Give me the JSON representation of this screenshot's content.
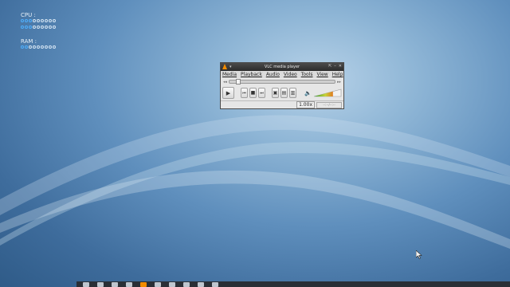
{
  "monitor": {
    "cpu_label": "CPU :",
    "ram_label": "RAM :",
    "cpu_rows": [
      {
        "on": 3,
        "total": 9
      },
      {
        "on": 3,
        "total": 9
      }
    ],
    "ram_rows": [
      {
        "on": 2,
        "total": 9
      }
    ]
  },
  "vlc": {
    "title": "VLC media player",
    "window_controls": [
      "⇱",
      "–",
      "✕"
    ],
    "menu": [
      "Media",
      "Playback",
      "Audio",
      "Video",
      "Tools",
      "View",
      "Help"
    ],
    "speed": "1.00x",
    "volume_level": 0.7,
    "accent": "#f28c00"
  },
  "taskbar": {
    "items": [
      "menu-icon",
      "files-icon",
      "terminal-icon",
      "browser-icon",
      "vlc-icon",
      "editor-icon",
      "settings-icon",
      "network-icon",
      "volume-icon",
      "clock-icon"
    ]
  }
}
